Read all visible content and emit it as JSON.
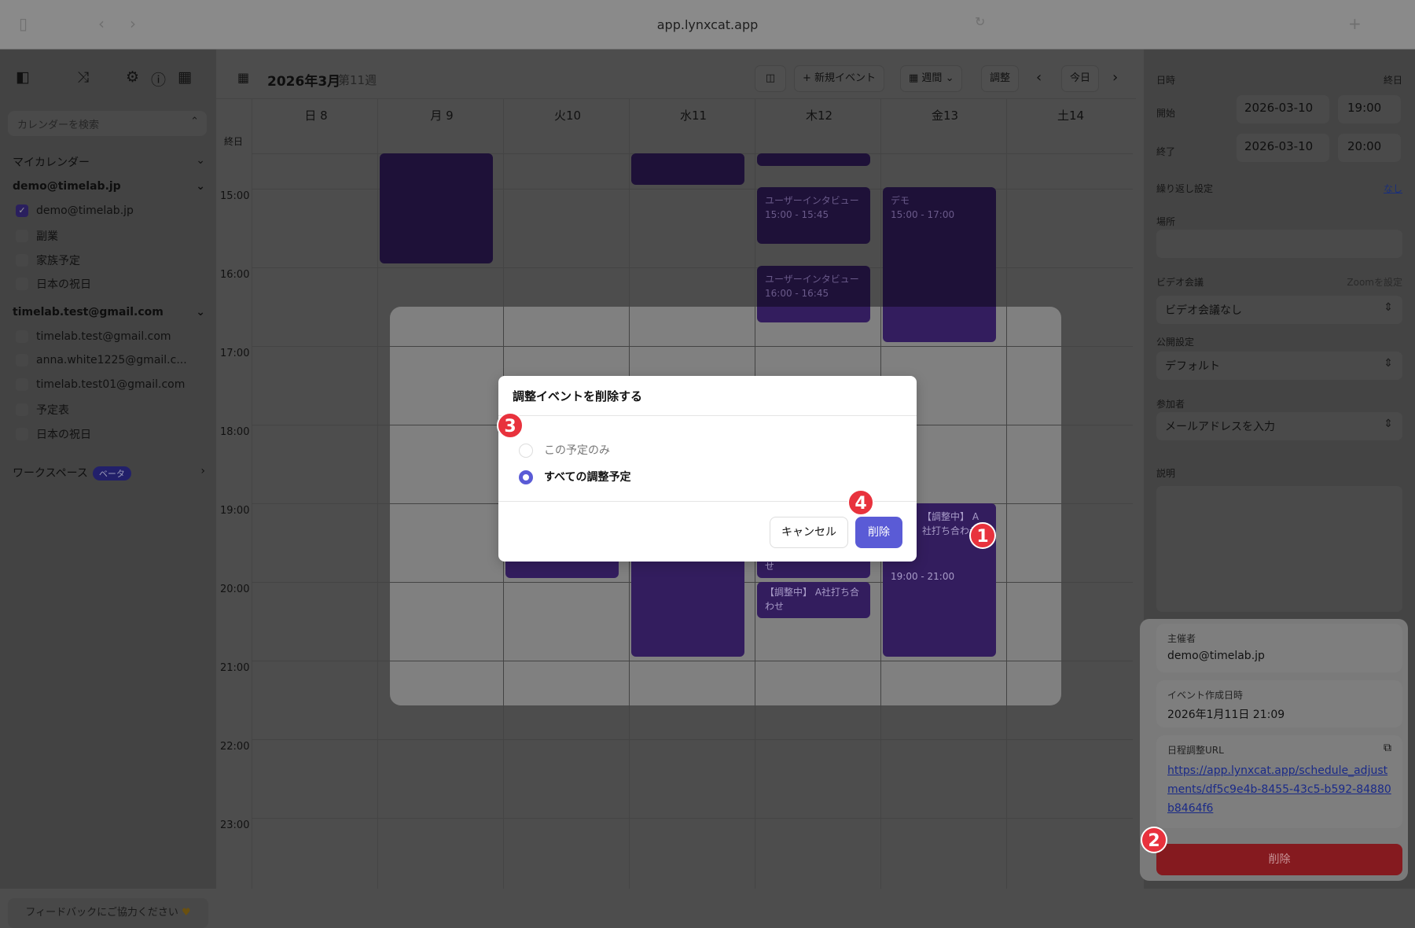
{
  "browser": {
    "url": "app.lynxcat.app"
  },
  "sidebar": {
    "search_placeholder": "カレンダーを検索",
    "my_calendars": "マイカレンダー",
    "accounts": [
      {
        "name": "demo@timelab.jp",
        "items": [
          {
            "label": "demo@timelab.jp",
            "checked": true
          },
          {
            "label": "副業"
          },
          {
            "label": "家族予定"
          },
          {
            "label": "日本の祝日"
          }
        ]
      },
      {
        "name": "timelab.test@gmail.com",
        "items": [
          {
            "label": "timelab.test@gmail.com"
          },
          {
            "label": "anna.white1225@gmail.c..."
          },
          {
            "label": "timelab.test01@gmail.com"
          },
          {
            "label": "予定表"
          },
          {
            "label": "日本の祝日"
          }
        ]
      }
    ],
    "workspace": "ワークスペース",
    "beta": "ベータ",
    "feedback": "フィードバックにご協力ください"
  },
  "calendar": {
    "title": "2026年3月",
    "week": "第11週",
    "new_event": "+ 新規イベント",
    "view": "週間",
    "adjust": "調整",
    "today": "今日",
    "allday": "終日",
    "days": [
      "日 8",
      "月 9",
      "火10",
      "水11",
      "木12",
      "金13",
      "土14"
    ],
    "hours": [
      "15:00",
      "16:00",
      "17:00",
      "18:00",
      "19:00",
      "20:00",
      "21:00",
      "22:00",
      "23:00"
    ],
    "events": [
      {
        "title": "ユーザーインタビュー",
        "time": "15:00 - 15:45"
      },
      {
        "title": "ユーザーインタビュー",
        "time": "16:00 - 16:45"
      },
      {
        "title": "デモ",
        "time": "15:00 - 17:00"
      },
      {
        "title": "【調整中】 A社打ち合わせ",
        "time": "19:00 - 21:00"
      },
      {
        "title": "【調整中】 A社打ち合わせ"
      },
      {
        "title_tail": "せ"
      }
    ]
  },
  "panel": {
    "datetime": "日時",
    "allday": "終日",
    "start": "開始",
    "start_date": "2026-03-10",
    "start_time": "19:00",
    "end": "終了",
    "end_date": "2026-03-10",
    "end_time": "20:00",
    "repeat": "繰り返し設定",
    "repeat_value": "なし",
    "location": "場所",
    "video": "ビデオ会議",
    "zoom": "Zoomを設定",
    "video_value": "ビデオ会議なし",
    "visibility": "公開設定",
    "visibility_value": "デフォルト",
    "attendees": "参加者",
    "attendees_placeholder": "メールアドレスを入力",
    "description": "説明",
    "organizer_label": "主催者",
    "organizer": "demo@timelab.jp",
    "created_label": "イベント作成日時",
    "created": "2026年1月11日 21:09",
    "url_label": "日程調整URL",
    "url": "https://app.lynxcat.app/schedule_adjustments/df5c9e4b-8455-43c5-b592-84880b8464f6",
    "delete": "削除"
  },
  "modal": {
    "title": "調整イベントを削除する",
    "option_this": "この予定のみ",
    "option_all": "すべての調整予定",
    "selected": "all",
    "cancel": "キャンセル",
    "delete": "削除"
  },
  "badges": [
    "1",
    "2",
    "3",
    "4"
  ],
  "colors": {
    "event": "#663abc",
    "primary": "#5a5bd6",
    "danger": "#b01c22",
    "badge": "#e8323d"
  }
}
